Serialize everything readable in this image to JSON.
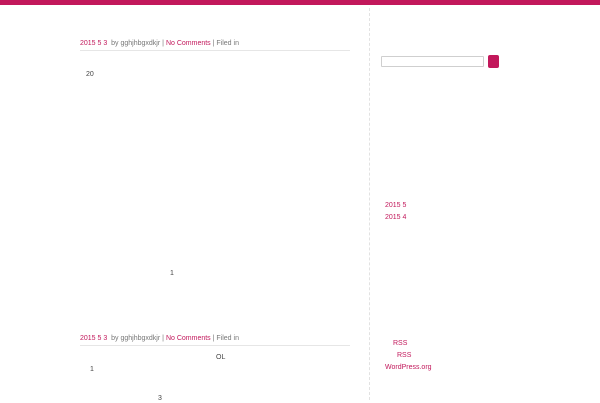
{
  "theme": {
    "accent": "#c2185b"
  },
  "posts": [
    {
      "date": "2015 5 3",
      "by": "by",
      "author": "gghjhbgxdkjr",
      "sep1": "|",
      "comments": "No Comments",
      "sep2": "|",
      "filed": "Filed in",
      "content": [
        "20",
        "1"
      ]
    },
    {
      "date": "2015 5 3",
      "by": "by",
      "author": "gghjhbgxdkjr",
      "sep1": "|",
      "comments": "No Comments",
      "sep2": "|",
      "filed": "Filed in",
      "content": [
        "OL",
        "1",
        "3"
      ]
    }
  ],
  "sidebar": {
    "search": {
      "value": "",
      "placeholder": "",
      "button_label": ""
    },
    "archives": [
      "2015 5",
      "2015 4"
    ],
    "meta_links": [
      "RSS",
      "RSS",
      "WordPress.org"
    ]
  }
}
